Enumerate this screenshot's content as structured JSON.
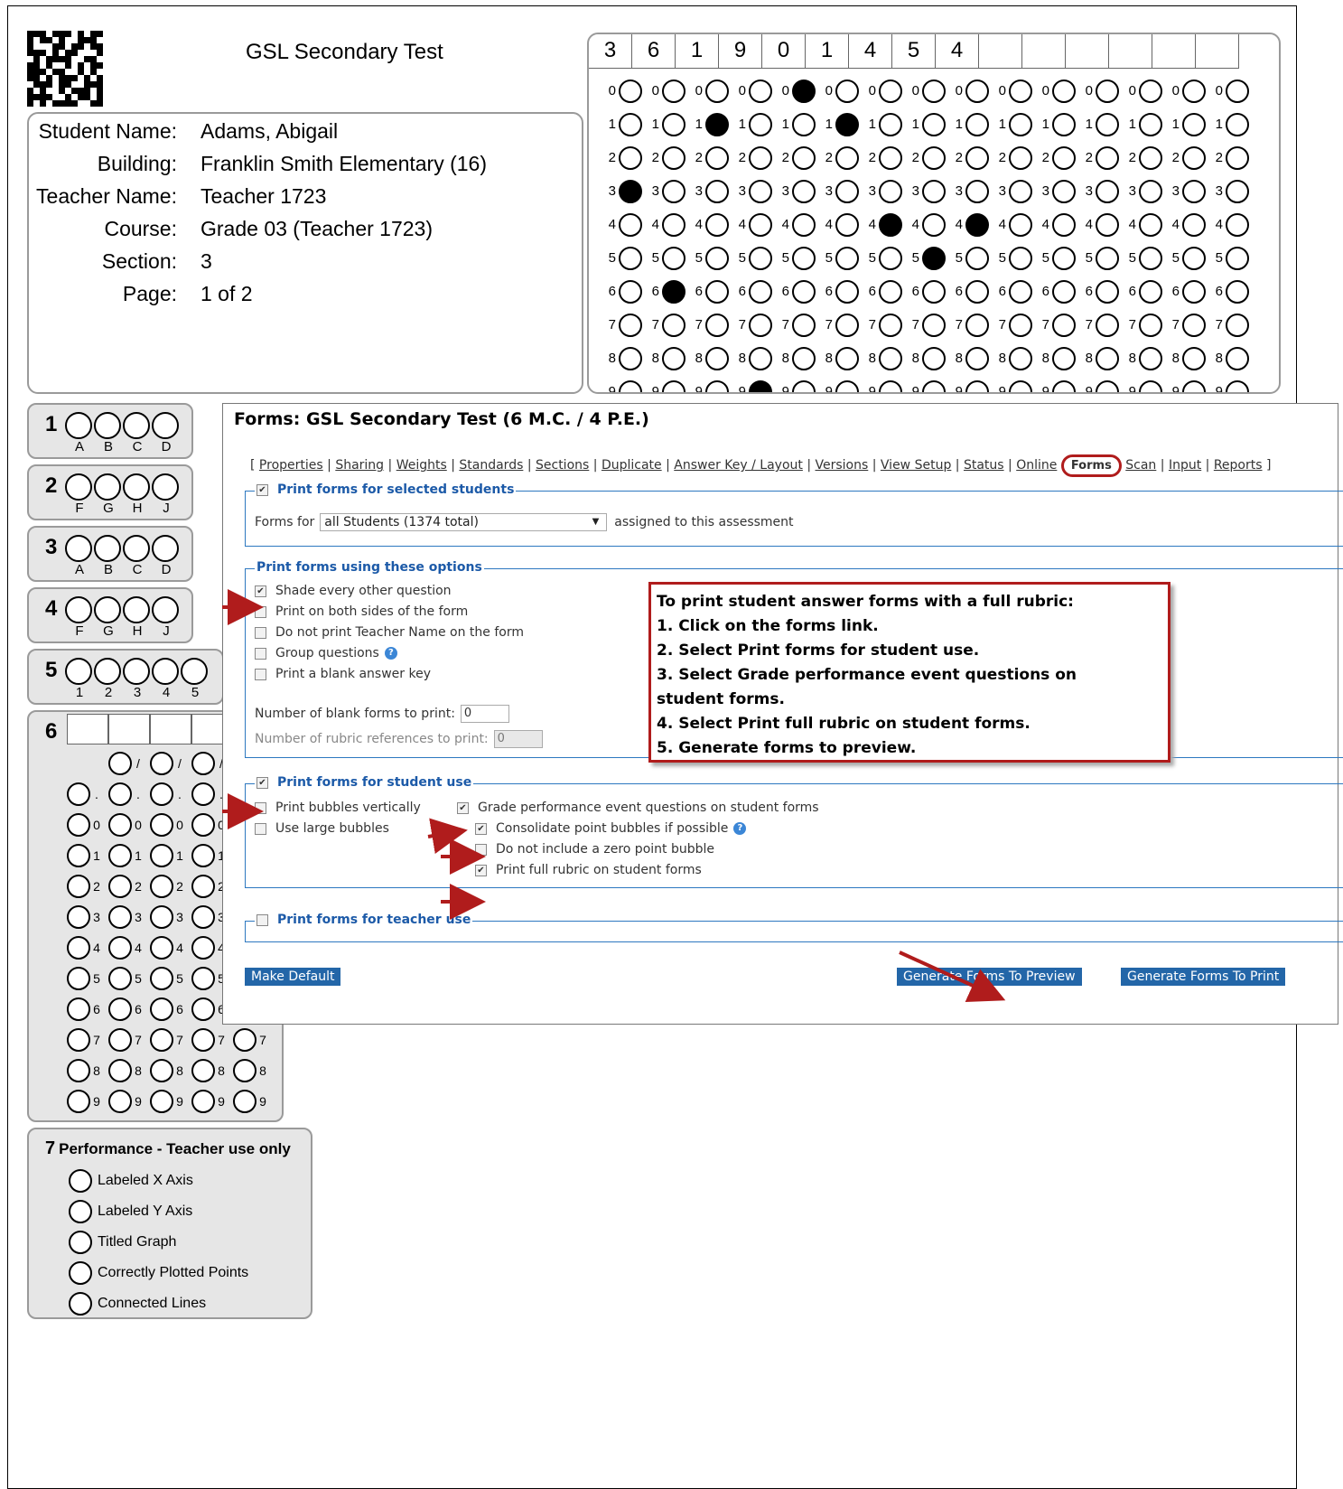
{
  "sheet": {
    "title": "GSL Secondary Test",
    "student": [
      {
        "label": "Student Name:",
        "value": "Adams, Abigail"
      },
      {
        "label": "Building:",
        "value": "Franklin Smith Elementary (16)"
      },
      {
        "label": "Teacher Name:",
        "value": "Teacher 1723"
      },
      {
        "label": "Course:",
        "value": "Grade 03 (Teacher 1723)"
      },
      {
        "label": "Section:",
        "value": "3"
      },
      {
        "label": "Page:",
        "value": "1 of 2"
      }
    ],
    "id_digits": [
      "3",
      "6",
      "1",
      "9",
      "0",
      "1",
      "4",
      "5",
      "4",
      "",
      "",
      "",
      "",
      "",
      ""
    ],
    "mc_questions": [
      {
        "number": "1",
        "letters": [
          "A",
          "B",
          "C",
          "D"
        ]
      },
      {
        "number": "2",
        "letters": [
          "F",
          "G",
          "H",
          "J"
        ]
      },
      {
        "number": "3",
        "letters": [
          "A",
          "B",
          "C",
          "D"
        ]
      },
      {
        "number": "4",
        "letters": [
          "F",
          "G",
          "H",
          "J"
        ]
      },
      {
        "number": "5",
        "letters": [
          "1",
          "2",
          "3",
          "4",
          "5"
        ]
      }
    ],
    "gridded_question_number": "6",
    "grid_symbols": [
      "/",
      ".",
      "0",
      "1",
      "2",
      "3",
      "4",
      "5",
      "6",
      "7",
      "8",
      "9"
    ],
    "performance": {
      "number": "7",
      "title": "Performance - Teacher use only",
      "items": [
        "Labeled X Axis",
        "Labeled Y Axis",
        "Titled Graph",
        "Correctly Plotted Points",
        "Connected Lines"
      ]
    }
  },
  "panel": {
    "title": "Forms: GSL Secondary Test (6 M.C. / 4 P.E.)",
    "nav_links": [
      "Properties",
      "Sharing",
      "Weights",
      "Standards",
      "Sections",
      "Duplicate",
      "Answer Key / Layout",
      "Versions",
      "View Setup",
      "Status",
      "Online",
      "Forms",
      "Scan",
      "Input",
      "Reports"
    ],
    "selected_students": {
      "legend": "Print forms for selected students",
      "checked": true,
      "forms_for_label": "Forms for",
      "select_value": "all Students (1374 total)",
      "suffix": "assigned to this assessment"
    },
    "options": {
      "legend": "Print forms using these options",
      "items": [
        {
          "label": "Shade every other question",
          "checked": true
        },
        {
          "label": "Print on both sides of the form",
          "checked": false
        },
        {
          "label": "Do not print Teacher Name on the form",
          "checked": false
        },
        {
          "label": "Group questions",
          "checked": false
        },
        {
          "label": "Print a blank answer key",
          "checked": false
        }
      ],
      "blank_forms_label": "Number of blank forms to print:",
      "blank_forms_value": "0",
      "rubric_refs_label": "Number of rubric references to print:",
      "rubric_refs_value": "0"
    },
    "student_use": {
      "legend": "Print forms for student use",
      "checked": true,
      "left_items": [
        {
          "label": "Print bubbles vertically",
          "checked": false
        },
        {
          "label": "Use large bubbles",
          "checked": false
        }
      ],
      "right_items": [
        {
          "label": "Grade performance event questions on student forms",
          "checked": true
        },
        {
          "label": "Consolidate point bubbles if possible",
          "checked": true
        },
        {
          "label": "Do not include a zero point bubble",
          "checked": false
        },
        {
          "label": "Print full rubric on student forms",
          "checked": true
        }
      ]
    },
    "teacher_use": {
      "legend": "Print forms for teacher use",
      "checked": false
    },
    "buttons": {
      "make_default": "Make Default",
      "preview": "Generate Forms To Preview",
      "print": "Generate Forms To Print"
    }
  },
  "callout": {
    "lines": [
      "To print student answer forms with a full rubric:",
      "1.  Click on the forms link.",
      "2.  Select Print forms for student use.",
      "3.  Select Grade performance event questions on",
      "student forms.",
      "4.  Select Print full rubric on student forms.",
      "5.  Generate forms to preview."
    ]
  },
  "colors": {
    "annotation_red": "#b01c1c",
    "legend_blue": "#1c5aa8",
    "button_blue": "#2366a8"
  }
}
